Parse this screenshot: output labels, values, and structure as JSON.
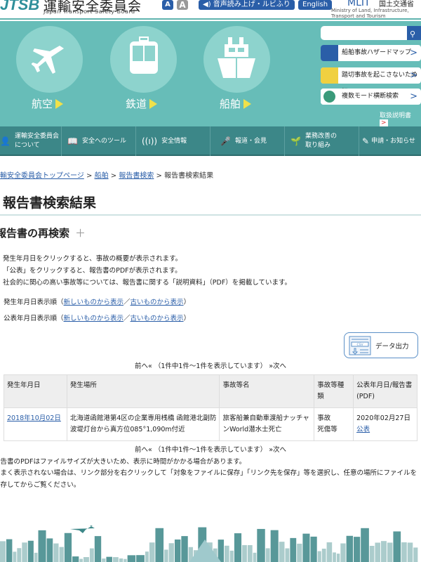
{
  "header": {
    "logo": "JTSB",
    "org_name": "運輸安全委員会",
    "org_name_en": "Japan Transport Safety Board",
    "font_small": "A",
    "font_large": "A",
    "read_aloud": "音声読み上げ・ルビふり",
    "english": "English",
    "mlit_logo": "MLIT",
    "mlit_name": "国土交通省",
    "mlit_en": "Ministry of Land, Infrastructure, Transport and Tourism"
  },
  "modes": [
    {
      "label": "航空",
      "icon": "airplane-icon"
    },
    {
      "label": "鉄道",
      "icon": "train-icon"
    },
    {
      "label": "船舶",
      "icon": "ship-icon"
    }
  ],
  "search": {
    "placeholder": "",
    "value": ""
  },
  "side_links": [
    {
      "label": "船舶事故ハザードマップ",
      "icon": "ship-icon",
      "color": "#2a5ea8"
    },
    {
      "label": "踏切事故を起こさないために",
      "icon": "train-icon",
      "color": "#f0d040"
    },
    {
      "label": "複数モード横断検索",
      "icon": "globe-icon",
      "color": "#3a9a7a"
    }
  ],
  "manual": "取扱説明書",
  "nav": [
    {
      "label": "運輸安全委員会について",
      "icon": "person-icon"
    },
    {
      "label": "安全へのツール",
      "icon": "book-icon"
    },
    {
      "label": "安全情報",
      "icon": "signal-icon"
    },
    {
      "label": "報道・会見",
      "icon": "microphone-icon"
    },
    {
      "label": "業務改善の取り組み",
      "icon": "sprout-icon"
    },
    {
      "label": "申請・お知らせ",
      "icon": "pencil-icon"
    }
  ],
  "breadcrumb": {
    "items": [
      "運輸安全委員会トップページ",
      "船舶",
      "報告書検索"
    ],
    "current": "報告書検索結果",
    "sep": ">"
  },
  "title": "報告書検索結果",
  "research": {
    "label": "報告書の再検索",
    "toggle": "＋"
  },
  "bullets": [
    "発生年月日をクリックすると、事故の概要が表示されます。",
    "「公表」をクリックすると、報告書のPDFが表示されます。",
    "社会的に関心の高い事故等については、報告書に関する「説明資料」（PDF）を掲載しています。"
  ],
  "sort": [
    {
      "label": "発生年月日表示順（",
      "newest": "新しいものから表示",
      "sep": "／",
      "oldest": "古いものから表示",
      "close": "）"
    },
    {
      "label": "公表年月日表示順（",
      "newest": "新しいものから表示",
      "sep": "／",
      "oldest": "古いものから表示",
      "close": "）"
    }
  ],
  "csv": {
    "badge": "CSV",
    "label": "データ出力"
  },
  "pagination": {
    "prev": "前へ«",
    "status": "（1件中1件～1件を表示しています）",
    "next": "»次へ"
  },
  "table": {
    "headers": [
      "発生年月日",
      "発生場所",
      "事故等名",
      "事故等種類",
      "公表年月日/報告書(PDF)"
    ],
    "rows": [
      {
        "date": "2018年10月02日",
        "place": "北海道函館港第4区の企業専用桟橋 函館港北副防波堤灯台から真方位085°1,090m付近",
        "name": "旅客船兼自動車渡船ナッチャンWorld潜水士死亡",
        "type1": "事故",
        "type2": "死傷等",
        "pub_date": "2020年02月27日",
        "pub_link": "公表"
      }
    ]
  },
  "notes": [
    "報告書のPDFはファイルサイズが大きいため、表示に時間がかかる場合があります。",
    "うまく表示されない場合は、リンク部分を右クリックして「対象をファイルに保存」「リンク先を保存」等を選択し、任意の場所にファイルを保存してからご覧ください。"
  ],
  "colors": {
    "teal": "#67bdb8",
    "nav": "#3c8788",
    "link": "#2a5ea8",
    "accent_yellow": "#f0e14a"
  }
}
